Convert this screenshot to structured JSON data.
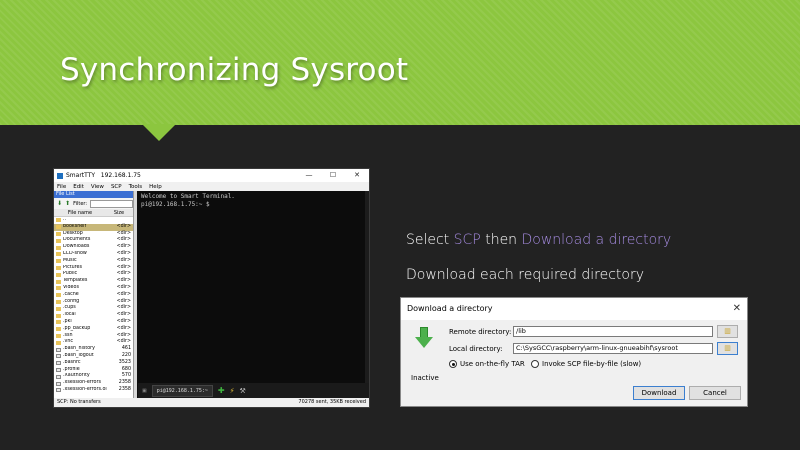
{
  "slide": {
    "title": "Synchronizing Sysroot",
    "instruction_1": {
      "prefix": "Select ",
      "hl1": "SCP",
      "mid": " then ",
      "hl2": "Download a directory"
    },
    "instruction_2": "Download each required directory",
    "colors": {
      "header": "#8cc63f",
      "background": "#222222",
      "highlight": "#a58be0"
    }
  },
  "smartty": {
    "window_title": "SmartTTY   192.168.1.75",
    "controls": [
      "—",
      "☐",
      "✕"
    ],
    "menu": [
      "File",
      "Edit",
      "View",
      "SCP",
      "Tools",
      "Help"
    ],
    "file_list_header": "File List",
    "filter_label": "Filter:",
    "columns": {
      "name": "File name",
      "size": "Size"
    },
    "files": [
      {
        "name": "..",
        "size": "",
        "type": "folder"
      },
      {
        "name": "bookshelf",
        "size": "<dir>",
        "type": "folder",
        "selected": true
      },
      {
        "name": "Desktop",
        "size": "<dir>",
        "type": "folder"
      },
      {
        "name": "Documents",
        "size": "<dir>",
        "type": "folder"
      },
      {
        "name": "Downloads",
        "size": "<dir>",
        "type": "folder"
      },
      {
        "name": "LCD-show",
        "size": "<dir>",
        "type": "folder"
      },
      {
        "name": "Music",
        "size": "<dir>",
        "type": "folder"
      },
      {
        "name": "Pictures",
        "size": "<dir>",
        "type": "folder"
      },
      {
        "name": "Public",
        "size": "<dir>",
        "type": "folder"
      },
      {
        "name": "Templates",
        "size": "<dir>",
        "type": "folder"
      },
      {
        "name": "Videos",
        "size": "<dir>",
        "type": "folder"
      },
      {
        "name": ".cache",
        "size": "<dir>",
        "type": "folder"
      },
      {
        "name": ".config",
        "size": "<dir>",
        "type": "folder"
      },
      {
        "name": ".cups",
        "size": "<dir>",
        "type": "folder"
      },
      {
        "name": ".local",
        "size": "<dir>",
        "type": "folder"
      },
      {
        "name": ".pki",
        "size": "<dir>",
        "type": "folder"
      },
      {
        "name": ".pp_backup",
        "size": "<dir>",
        "type": "folder"
      },
      {
        "name": ".ssh",
        "size": "<dir>",
        "type": "folder"
      },
      {
        "name": ".vnc",
        "size": "<dir>",
        "type": "folder"
      },
      {
        "name": ".bash_history",
        "size": "461",
        "type": "file"
      },
      {
        "name": ".bash_logout",
        "size": "220",
        "type": "file"
      },
      {
        "name": ".bashrc",
        "size": "3523",
        "type": "file"
      },
      {
        "name": ".profile",
        "size": "680",
        "type": "file"
      },
      {
        "name": ".Xauthority",
        "size": "570",
        "type": "file"
      },
      {
        "name": ".xsession-errors",
        "size": "2358",
        "type": "file"
      },
      {
        "name": ".xsession-errors.old",
        "size": "2358",
        "type": "file"
      }
    ],
    "terminal_lines": [
      "Welcome to Smart Terminal.",
      "pi@192.168.1.75:~ $"
    ],
    "tab_label": "pi@192.168.1.75:~",
    "status_left": "SCP: No transfers",
    "status_right": "70278 sent, 35KB received"
  },
  "dialog": {
    "title": "Download a directory",
    "close": "✕",
    "remote_label": "Remote directory:",
    "remote_value": "/lib",
    "local_label": "Local directory:",
    "local_value": "C:\\SysGCC\\raspberry\\arm-linux-gnueabihf\\sysroot",
    "option_tar": "Use on-the-fly TAR",
    "option_scp": "Invoke SCP file-by-file (slow)",
    "status": "Inactive",
    "download_button": "Download",
    "cancel_button": "Cancel"
  }
}
